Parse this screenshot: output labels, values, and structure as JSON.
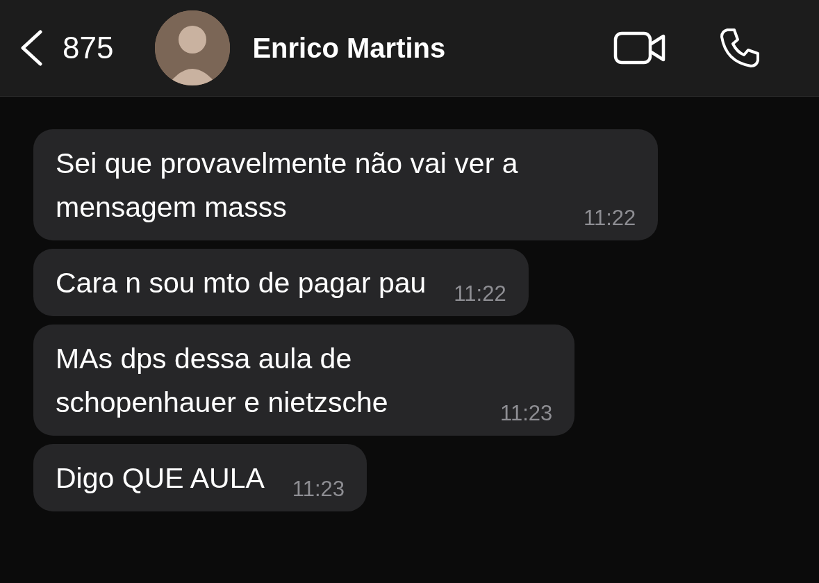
{
  "header": {
    "back_count": "875",
    "contact_name": "Enrico Martins"
  },
  "messages": [
    {
      "text": "Sei que provavelmente não vai ver a mensagem masss",
      "time": "11:22"
    },
    {
      "text": "Cara n sou mto de pagar pau",
      "time": "11:22"
    },
    {
      "text": "MAs dps dessa aula de schopenhauer e nietzsche",
      "time": "11:23"
    },
    {
      "text": "Digo QUE AULA",
      "time": "11:23"
    }
  ]
}
